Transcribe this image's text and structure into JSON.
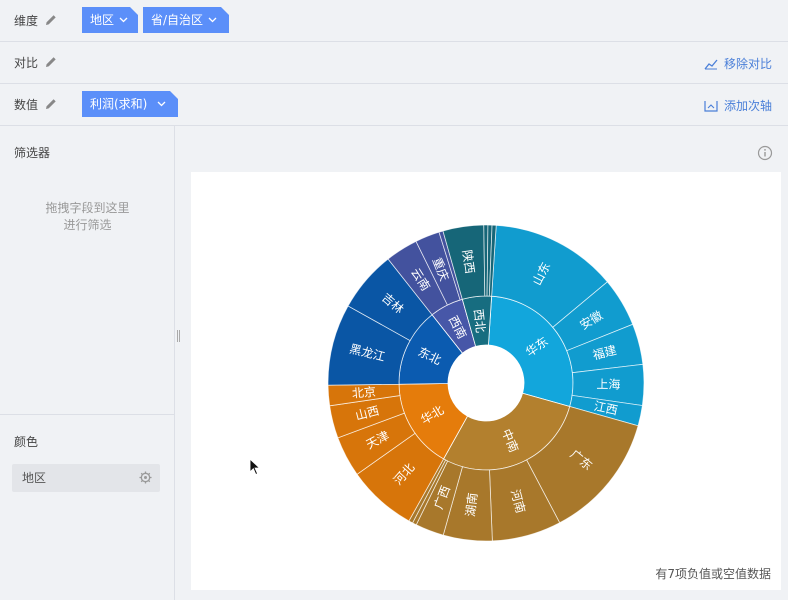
{
  "shelves": {
    "dimension": {
      "label": "维度",
      "pills": [
        "地区",
        "省/自治区"
      ]
    },
    "compare": {
      "label": "对比",
      "action": "移除对比"
    },
    "values": {
      "label": "数值",
      "pills": [
        "利润(求和)"
      ],
      "action": "添加次轴"
    }
  },
  "filter": {
    "title": "筛选器",
    "hint_line1": "拖拽字段到这里",
    "hint_line2": "进行筛选"
  },
  "color": {
    "title": "颜色",
    "field": "地区"
  },
  "icons": {
    "edit": "pencil-icon",
    "dropdown": "chevron-down-icon",
    "settings": "gear-icon",
    "info": "info-icon",
    "remove-compare": "chart-remove-icon",
    "add-axis": "axis-add-icon"
  },
  "chart_note": "有7项负值或空值数据",
  "chart_data": {
    "type": "sunburst",
    "hierarchy": [
      "地区",
      "省/自治区"
    ],
    "measure": "利润(求和)",
    "regions": [
      {
        "name": "华东",
        "color": "#12a6dc",
        "provinces": [
          {
            "name": "山东",
            "value": 31
          },
          {
            "name": "安徽",
            "value": 12
          },
          {
            "name": "福建",
            "value": 10
          },
          {
            "name": "上海",
            "value": 10
          },
          {
            "name": "江西",
            "value": 5
          }
        ]
      },
      {
        "name": "中南",
        "color": "#b3802e",
        "provinces": [
          {
            "name": "广东",
            "value": 31
          },
          {
            "name": "河南",
            "value": 17
          },
          {
            "name": "湖南",
            "value": 12
          },
          {
            "name": "广西",
            "value": 7
          },
          {
            "name": "",
            "value": 1
          },
          {
            "name": "",
            "value": 1
          }
        ]
      },
      {
        "name": "华北",
        "color": "#e57c0b",
        "provinces": [
          {
            "name": "河北",
            "value": 17
          },
          {
            "name": "天津",
            "value": 10
          },
          {
            "name": "山西",
            "value": 8
          },
          {
            "name": "北京",
            "value": 5
          }
        ]
      },
      {
        "name": "东北",
        "color": "#0b5bb0",
        "provinces": [
          {
            "name": "黑龙江",
            "value": 20
          },
          {
            "name": "吉林",
            "value": 15
          }
        ]
      },
      {
        "name": "西南",
        "color": "#4757a8",
        "provinces": [
          {
            "name": "云南",
            "value": 8
          },
          {
            "name": "重庆",
            "value": 6
          },
          {
            "name": "",
            "value": 1
          }
        ]
      },
      {
        "name": "西北",
        "color": "#176d80",
        "provinces": [
          {
            "name": "陕西",
            "value": 10
          },
          {
            "name": "",
            "value": 1
          },
          {
            "name": "",
            "value": 1
          },
          {
            "name": "",
            "value": 1
          }
        ]
      }
    ]
  }
}
